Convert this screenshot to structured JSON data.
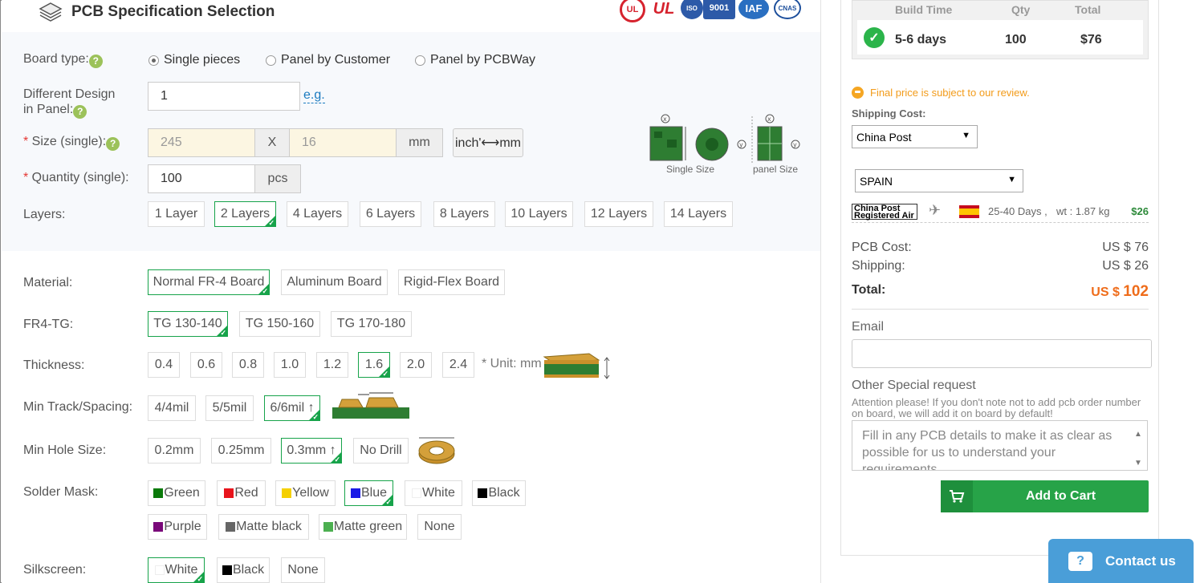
{
  "header": {
    "title": "PCB Specification Selection"
  },
  "certs": [
    "UL",
    "UL",
    "ISO",
    "9001",
    "IAF",
    "CNAS"
  ],
  "board_type": {
    "label": "Board type:",
    "options": [
      "Single pieces",
      "Panel by Customer",
      "Panel by PCBWay"
    ],
    "selected": "Single pieces"
  },
  "diff_design": {
    "label1": "Different Design",
    "label2": "in Panel:",
    "value": "1",
    "eg": "e.g."
  },
  "size": {
    "label": "Size (single):",
    "width": "245",
    "x": "X",
    "height": "16",
    "unit": "mm",
    "toggle": "inch'⟷mm"
  },
  "quantity": {
    "label": "Quantity (single):",
    "value": "100",
    "unit": "pcs"
  },
  "diagram": {
    "single": "Single Size",
    "panel": "panel Size"
  },
  "layers": {
    "label": "Layers:",
    "options": [
      "1 Layer",
      "2 Layers",
      "4 Layers",
      "6 Layers",
      "8 Layers",
      "10 Layers",
      "12 Layers",
      "14 Layers"
    ],
    "selected": "2 Layers"
  },
  "material": {
    "label": "Material:",
    "options": [
      "Normal FR-4 Board",
      "Aluminum Board",
      "Rigid-Flex Board"
    ],
    "selected": "Normal FR-4 Board"
  },
  "fr4tg": {
    "label": "FR4-TG:",
    "options": [
      "TG 130-140",
      "TG 150-160",
      "TG 170-180"
    ],
    "selected": "TG 130-140"
  },
  "thickness": {
    "label": "Thickness:",
    "options": [
      "0.4",
      "0.6",
      "0.8",
      "1.0",
      "1.2",
      "1.6",
      "2.0",
      "2.4"
    ],
    "selected": "1.6",
    "unit_note": "* Unit: mm"
  },
  "track": {
    "label": "Min Track/Spacing:",
    "options": [
      "4/4mil",
      "5/5mil",
      "6/6mil ↑"
    ],
    "selected": "6/6mil ↑"
  },
  "hole": {
    "label": "Min Hole Size:",
    "options": [
      "0.2mm",
      "0.25mm",
      "0.3mm ↑",
      "No Drill"
    ],
    "selected": "0.3mm ↑"
  },
  "solder": {
    "label": "Solder Mask:",
    "options": [
      {
        "name": "Green",
        "color": "#0a7a0a"
      },
      {
        "name": "Red",
        "color": "#e8141c"
      },
      {
        "name": "Yellow",
        "color": "#f5d000"
      },
      {
        "name": "Blue",
        "color": "#1a1ae6"
      },
      {
        "name": "White",
        "color": "#ffffff"
      },
      {
        "name": "Black",
        "color": "#000000"
      },
      {
        "name": "Purple",
        "color": "#7a0a7a"
      },
      {
        "name": "Matte black",
        "color": "#666666"
      },
      {
        "name": "Matte green",
        "color": "#4caf50"
      },
      {
        "name": "None",
        "color": ""
      }
    ],
    "selected": "Blue"
  },
  "silkscreen": {
    "label": "Silkscreen:",
    "options": [
      {
        "name": "White",
        "color": "#ffffff"
      },
      {
        "name": "Black",
        "color": "#000000"
      },
      {
        "name": "None",
        "color": ""
      }
    ],
    "selected": "White"
  },
  "quote": {
    "headers": [
      "Build Time",
      "Qty",
      "Total"
    ],
    "build_time": "5-6 days",
    "qty": "100",
    "total": "$76"
  },
  "note": "Final price is subject to our review.",
  "shipping": {
    "label": "Shipping Cost:",
    "carrier": "China Post",
    "country": "SPAIN",
    "logo_text": "China Post Registered Air",
    "days": "25-40 Days ,",
    "weight": "wt : 1.87 kg",
    "price": "$26"
  },
  "costs": {
    "pcb_label": "PCB Cost:",
    "pcb_value": "US $ 76",
    "ship_label": "Shipping:",
    "ship_value": "US $ 26",
    "total_label": "Total:",
    "total_prefix": "US $",
    "total_value": "102"
  },
  "email": {
    "label": "Email",
    "value": ""
  },
  "special": {
    "label": "Other Special request",
    "attention": "Attention please! If you don't note not to add pcb order number on board, we will add it on board by default!",
    "placeholder": "Fill in any PCB details to make it as clear as possible for us to understand your requirements."
  },
  "cart": {
    "label": "Add to Cart"
  },
  "contact": {
    "label": "Contact us"
  },
  "colors": {
    "accent_green": "#17a34a",
    "cart_green": "#27a348",
    "total_orange": "#ef6c1a",
    "note_orange": "#f29b1a",
    "contact_blue": "#4a9ed8"
  }
}
